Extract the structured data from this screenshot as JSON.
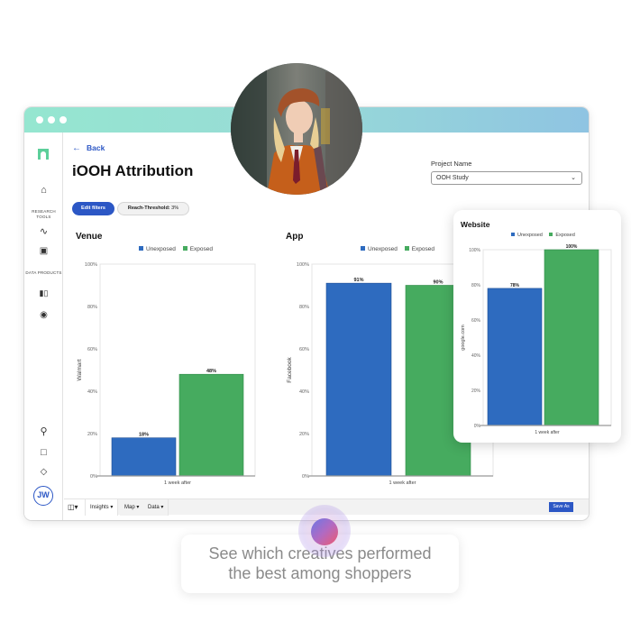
{
  "window": {
    "title_dots": 3
  },
  "sidebar": {
    "sections": [
      {
        "label": "RESEARCH TOOLS"
      },
      {
        "label": "DATA PRODUCTS"
      }
    ],
    "icons": [
      "logo",
      "home-icon",
      "activity-icon",
      "clipboard-icon",
      "bar-chart-icon",
      "globe-icon",
      "lightbulb-icon",
      "chat-icon",
      "graduation-cap-icon"
    ],
    "avatar_initials": "JW"
  },
  "header": {
    "back_label": "Back",
    "title": "iOOH Attribution",
    "project_label": "Project Name",
    "project_value": "OOH Study"
  },
  "filters": {
    "edit_label": "Edit filters",
    "reach_label": "Reach-Threshold:",
    "reach_value": "3%"
  },
  "legend": {
    "unexposed": "Unexposed",
    "exposed": "Exposed"
  },
  "colors": {
    "unexposed": "#2e6bbf",
    "exposed": "#46ab5f",
    "accent": "#2c57c5"
  },
  "bottom_bar": {
    "tabs": [
      "Insights",
      "Map",
      "Data"
    ],
    "save_label": "Save As"
  },
  "caption": {
    "line1": "See which creatives performed",
    "line2": "the best among shoppers"
  },
  "chart_data": [
    {
      "type": "bar",
      "title": "Venue",
      "categories": [
        "1 week after"
      ],
      "series": [
        {
          "name": "Unexposed",
          "values": [
            18
          ]
        },
        {
          "name": "Exposed",
          "values": [
            48
          ]
        }
      ],
      "data_labels": [
        "18%",
        "48%"
      ],
      "xlabel": "1 week after",
      "ylabel": "Walmart",
      "ylim": [
        0,
        100
      ],
      "yticks": [
        "0%",
        "20%",
        "40%",
        "60%",
        "80%",
        "100%"
      ],
      "legend": "top-center"
    },
    {
      "type": "bar",
      "title": "App",
      "categories": [
        "1 week after"
      ],
      "series": [
        {
          "name": "Unexposed",
          "values": [
            91
          ]
        },
        {
          "name": "Exposed",
          "values": [
            90
          ]
        }
      ],
      "data_labels": [
        "91%",
        "90%"
      ],
      "xlabel": "1 week after",
      "ylabel": "Facebook",
      "ylim": [
        0,
        100
      ],
      "yticks": [
        "0%",
        "20%",
        "40%",
        "60%",
        "80%",
        "100%"
      ],
      "legend": "top-center"
    },
    {
      "type": "bar",
      "title": "Website",
      "categories": [
        "1 week after"
      ],
      "series": [
        {
          "name": "Unexposed",
          "values": [
            78
          ]
        },
        {
          "name": "Exposed",
          "values": [
            100
          ]
        }
      ],
      "data_labels": [
        "78%",
        "100%"
      ],
      "xlabel": "1 week after",
      "ylabel": "google.com",
      "ylim": [
        0,
        100
      ],
      "yticks": [
        "0%",
        "20%",
        "40%",
        "60%",
        "80%",
        "100%"
      ],
      "legend": "top-center"
    }
  ]
}
